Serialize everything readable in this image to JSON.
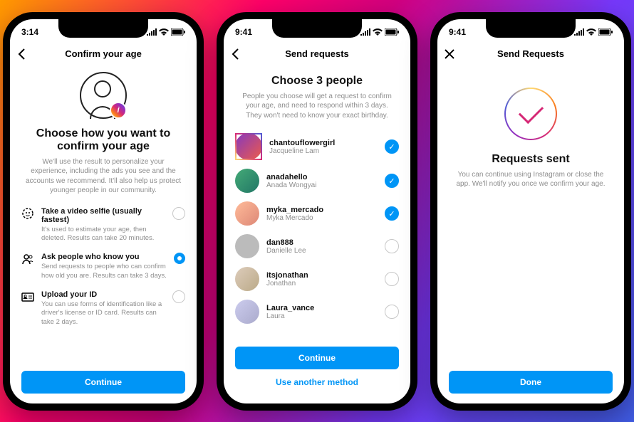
{
  "status": {
    "time1": "3:14",
    "time2": "9:41",
    "time3": "9:41"
  },
  "phone1": {
    "header": "Confirm your age",
    "title": "Choose how you want to confirm your age",
    "subtitle": "We'll use the result to personalize your experience, including the ads you see and the accounts we recommend. It'll also help us protect younger people in our community.",
    "options": [
      {
        "title": "Take a video selfie (usually fastest)",
        "sub": "It's used to estimate your age, then deleted. Results can take 20 minutes."
      },
      {
        "title": "Ask people who know you",
        "sub": "Send requests to people who can confirm how old you are. Results can take 3 days."
      },
      {
        "title": "Upload your ID",
        "sub": "You can use forms of identification like a driver's license or ID card. Results can take 2 days."
      }
    ],
    "cta": "Continue"
  },
  "phone2": {
    "header": "Send requests",
    "title": "Choose 3 people",
    "subtitle": "People you choose will get a request to confirm your age, and need to respond within 3 days. They won't need to know your exact birthday.",
    "people": [
      {
        "name": "chantouflowergirl",
        "sub": "Jacqueline Lam",
        "on": true
      },
      {
        "name": "anadahello",
        "sub": "Anada Wongyai",
        "on": true
      },
      {
        "name": "myka_mercado",
        "sub": "Myka Mercado",
        "on": true
      },
      {
        "name": "dan888",
        "sub": "Danielle Lee",
        "on": false
      },
      {
        "name": "itsjonathan",
        "sub": "Jonathan",
        "on": false
      },
      {
        "name": "Laura_vance",
        "sub": "Laura",
        "on": false
      }
    ],
    "cta": "Continue",
    "alt": "Use another method"
  },
  "phone3": {
    "header": "Send Requests",
    "title": "Requests sent",
    "subtitle": "You can continue using Instagram or close the app. We'll notify you once we confirm your age.",
    "cta": "Done"
  }
}
